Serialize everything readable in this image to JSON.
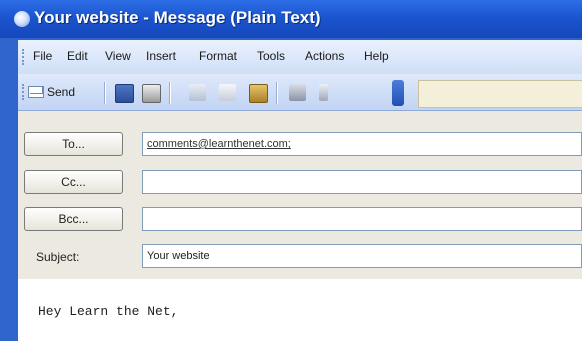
{
  "window": {
    "title": "Your website - Message (Plain Text)"
  },
  "menu": [
    "File",
    "Edit",
    "View",
    "Insert",
    "Format",
    "Tools",
    "Actions",
    "Help"
  ],
  "toolbar": {
    "send_label": "Send"
  },
  "fields": {
    "to_label": "To...",
    "to_value": "comments@learnthenet.com;",
    "cc_label": "Cc...",
    "cc_value": "",
    "bcc_label": "Bcc...",
    "bcc_value": "",
    "subject_label": "Subject:",
    "subject_value": "Your website"
  },
  "body": {
    "text": "Hey Learn the Net,"
  },
  "colors": {
    "titlebar": "#1b55cf",
    "menubar": "#d9e6fa",
    "header_bg": "#eceae0"
  }
}
